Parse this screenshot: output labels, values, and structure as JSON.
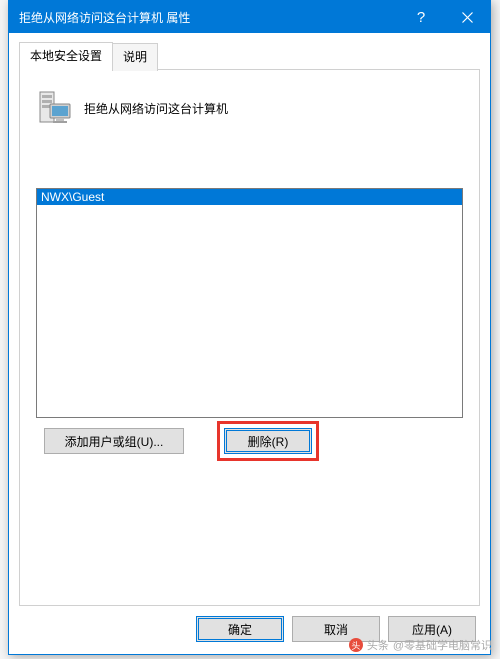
{
  "titlebar": {
    "title": "拒绝从网络访问这台计算机 属性",
    "help": "?",
    "close": "×"
  },
  "tabs": {
    "active": "本地安全设置",
    "inactive": "说明"
  },
  "panel": {
    "heading": "拒绝从网络访问这台计算机"
  },
  "list": {
    "items": [
      "NWX\\Guest"
    ]
  },
  "buttons": {
    "add": "添加用户或组(U)...",
    "remove": "删除(R)"
  },
  "footer": {
    "ok": "确定",
    "cancel": "取消",
    "apply": "应用(A)"
  },
  "watermark": {
    "prefix": "头条",
    "text": "@零基础学电脑常识"
  }
}
